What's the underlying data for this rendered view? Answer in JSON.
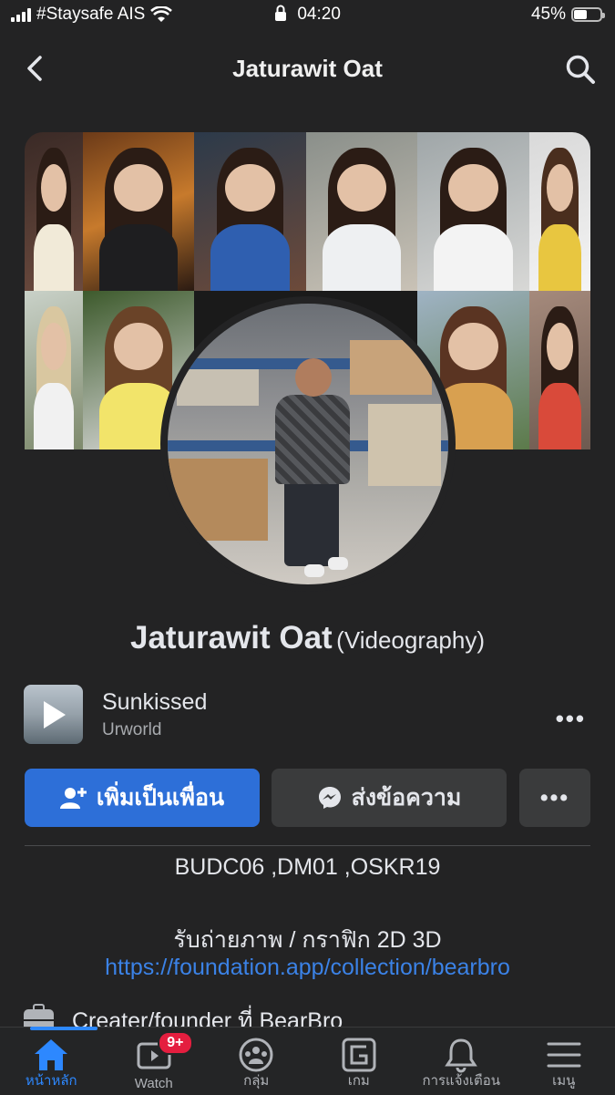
{
  "status_bar": {
    "carrier": "#Staysafe AIS",
    "time": "04:20",
    "battery_percent": "45%",
    "battery_level": 0.45
  },
  "nav": {
    "title": "Jaturawit Oat",
    "back_icon": "chevron-left-icon",
    "search_icon": "search-icon"
  },
  "profile": {
    "name": "Jaturawit Oat",
    "alt_name": "(Videography)"
  },
  "music": {
    "song": "Sunkissed",
    "artist": "Urworld",
    "more": "•••"
  },
  "actions": {
    "add_friend": "เพิ่มเป็นเพื่อน",
    "message": "ส่งข้อความ",
    "more": "•••"
  },
  "bio": {
    "line1": "BUDC06 ,DM01 ,OSKR19",
    "line2": "รับถ่ายภาพ / กราฟิก 2D 3D",
    "link": "https://foundation.app/collection/bearbro"
  },
  "work": {
    "text": "Creater/founder ที่ BearBro"
  },
  "tabs": [
    {
      "label": "หน้าหลัก",
      "icon": "home-icon",
      "active": true
    },
    {
      "label": "Watch",
      "icon": "watch-icon",
      "badge": "9+"
    },
    {
      "label": "กลุ่ม",
      "icon": "groups-icon"
    },
    {
      "label": "เกม",
      "icon": "gaming-icon"
    },
    {
      "label": "การแจ้งเตือน",
      "icon": "bell-icon"
    },
    {
      "label": "เมนู",
      "icon": "menu-icon"
    }
  ],
  "colors": {
    "accent": "#2d6fd8",
    "link": "#3b82e6",
    "background": "#232324",
    "badge": "#e41e3f"
  }
}
